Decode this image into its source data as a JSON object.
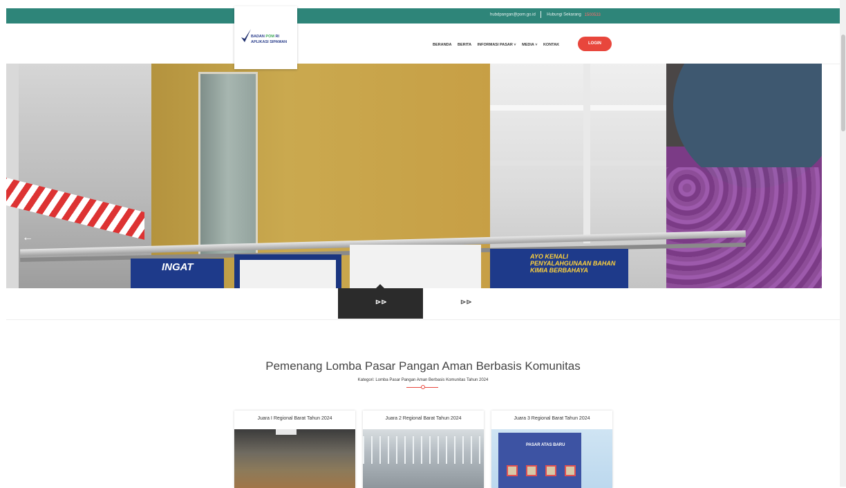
{
  "topbar": {
    "email": "hubdpangan@pom.go.id",
    "hotline_label": "Hubungi Sekarang",
    "hotline_number": "1500533",
    "color": "#2e8579"
  },
  "brand": {
    "line1_prefix": "BADAN",
    "line1_highlight": "POM",
    "line1_suffix": "RI",
    "line2": "APLIKASI SIPAMAN"
  },
  "nav": {
    "items": [
      {
        "label": "BERANDA"
      },
      {
        "label": "BERITA"
      },
      {
        "label": "INFORMASI PASAR ˅"
      },
      {
        "label": "MEDIA ˅"
      },
      {
        "label": "KONTAK"
      }
    ],
    "login_label": "LOGIN",
    "login_color": "#e8463c"
  },
  "hero": {
    "prev_icon": "arrow-left-icon",
    "next_icon": "arrow-right-icon",
    "banner1_text": "INGAT",
    "banner4_text": "AYO KENALI PENYALAHGUNAAN BAHAN KIMIA BERBAHAYA"
  },
  "tabs": [
    {
      "icon": "double-chevron-right-icon",
      "glyph": "⊳⊳",
      "active": true
    },
    {
      "icon": "double-chevron-right-icon",
      "glyph": "⊳⊳",
      "active": false
    }
  ],
  "section": {
    "title": "Pemenang Lomba Pasar Pangan Aman Berbasis Komunitas",
    "subtitle": "Kategori: Lomba Pasar Pangan Aman Berbasis Komunitas Tahun 2024"
  },
  "cards": [
    {
      "title": "Juara I Regional Barat Tahun 2024"
    },
    {
      "title": "Juara 2 Regional Barat Tahun 2024"
    },
    {
      "title": "Juara 3 Regional Barat Tahun 2024",
      "image_sign": "PASAR ATAS BARU"
    }
  ]
}
